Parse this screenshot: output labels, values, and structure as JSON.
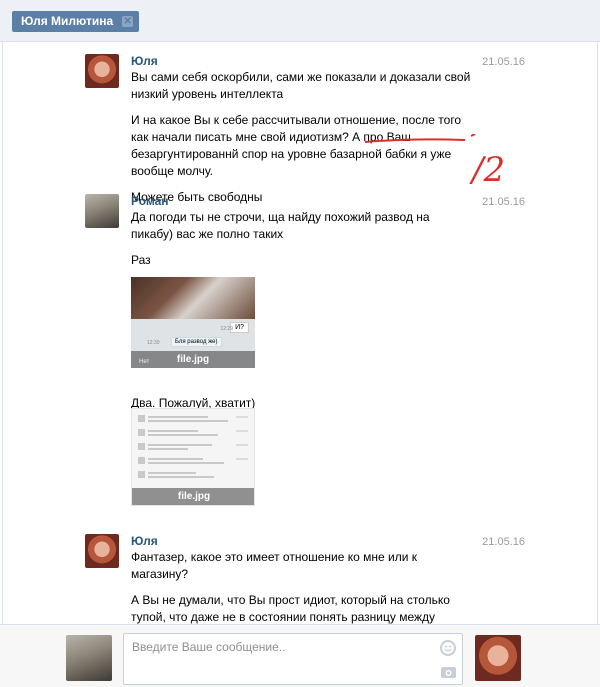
{
  "tab": {
    "title": "Юля Милютина",
    "close": "✕"
  },
  "messages": [
    {
      "author": "Юля",
      "date": "21.05.16",
      "paragraphs": [
        "Вы сами себя оскорбили, сами же показали и доказали свой низкий уровень интеллекта",
        "И на какое Вы к себе рассчитывали отношение, после того как начали писать мне свой идиотизм? А про Ваш безаргунтированнй спор на уровне базарной бабки я уже вообще молчу.",
        "Можете быть свободны"
      ]
    },
    {
      "author": "Роман",
      "date": "21.05.16",
      "paragraphs": [
        "Да погоди ты не строчи, ща найду похожий развод на пикабу) вас же полно таких",
        "Раз"
      ],
      "attachment1": {
        "caption": "file.jpg",
        "bubble_right": "И?",
        "time_right": "12:29",
        "bubble_left": "Бля развод же)",
        "time_left": "12:30",
        "bottom_left": "Нет"
      },
      "paragraph_after": "Два. Пожалуй, хватит)",
      "attachment2": {
        "caption": "file.jpg"
      }
    },
    {
      "author": "Юля",
      "date": "21.05.16",
      "paragraphs": [
        "Фантазер, какое это имеет отношение ко мне или к магазину?",
        "А Вы не думали, что Вы прост идиот, который на столько тупой, что даже не в состоянии понять разницу между рекламной акцией и разводом?"
      ]
    }
  ],
  "annotation": {
    "text": "/2",
    "color": "#d9302c"
  },
  "composer": {
    "placeholder": "Введите Ваше сообщение.."
  },
  "colors": {
    "accent": "#5b7fa6",
    "author": "#2b587a",
    "date": "#999999"
  }
}
